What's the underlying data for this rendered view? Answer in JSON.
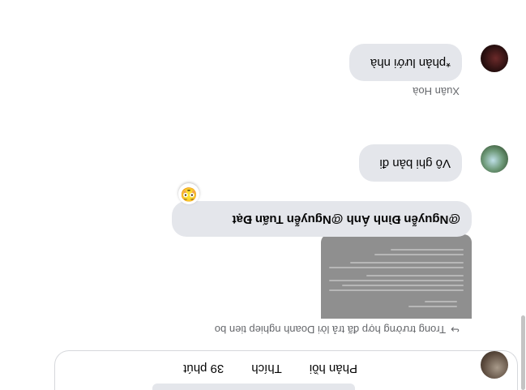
{
  "composer": {
    "time": "39 phút",
    "like_label": "Thích",
    "reply_label": "Phản hồi"
  },
  "reply_note": {
    "icon": "reply-arrow-icon",
    "text": "Trong trường hợp đã trả lời Doanh nghiep tien bo"
  },
  "shared_image": {
    "description_hidden": true
  },
  "comments": [
    {
      "text": "@Nguyễn Đình Ánh @Nguyễn Tuấn Đạt",
      "reaction": "😳"
    },
    {
      "text": "Vô ghi bản đi"
    },
    {
      "author": "Xuân Hoà",
      "text": "*phản lưới nhà"
    }
  ],
  "colors": {
    "bubble": "#e4e6eb",
    "meta_text": "#65676b",
    "background": "#ffffff"
  }
}
